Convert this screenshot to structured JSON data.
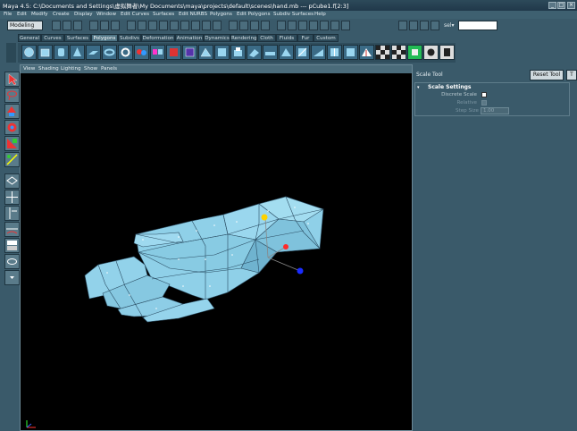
{
  "window": {
    "title": "Maya 4.5: C:\\Documents and Settings\\虚拟舞者\\My Documents\\maya\\projects\\default\\scenes\\hand.mb   ---   pCube1.f[2:3]"
  },
  "menubar": [
    "File",
    "Edit",
    "Modify",
    "Create",
    "Display",
    "Window",
    "Edit Curves",
    "Surfaces",
    "Edit NURBS",
    "Polygons",
    "Edit Polygons",
    "Subdiv Surfaces",
    "Help"
  ],
  "statusline": {
    "mode": "Modeling",
    "sel_label": "sel▾"
  },
  "shelf_tabs": [
    "General",
    "Curves",
    "Surfaces",
    "Polygons",
    "Subdivs",
    "Deformation",
    "Animation",
    "Dynamics",
    "Rendering",
    "Cloth",
    "Fluids",
    "Fur",
    "Custom"
  ],
  "active_shelf_tab": "Polygons",
  "panel_menu": [
    "View",
    "Shading",
    "Lighting",
    "Show",
    "Panels"
  ],
  "tool_settings": {
    "tool_name": "Scale Tool",
    "reset_label": "Reset Tool",
    "extra_label": "T",
    "section_title": "Scale Settings",
    "discrete_scale_label": "Discrete Scale",
    "relative_label": "Relative",
    "step_size_label": "Step Size",
    "step_size_value": "1.00"
  },
  "colors": {
    "accent": "#4f7484",
    "mesh": "#8fd4ea",
    "viewport_bg": "#000000"
  }
}
